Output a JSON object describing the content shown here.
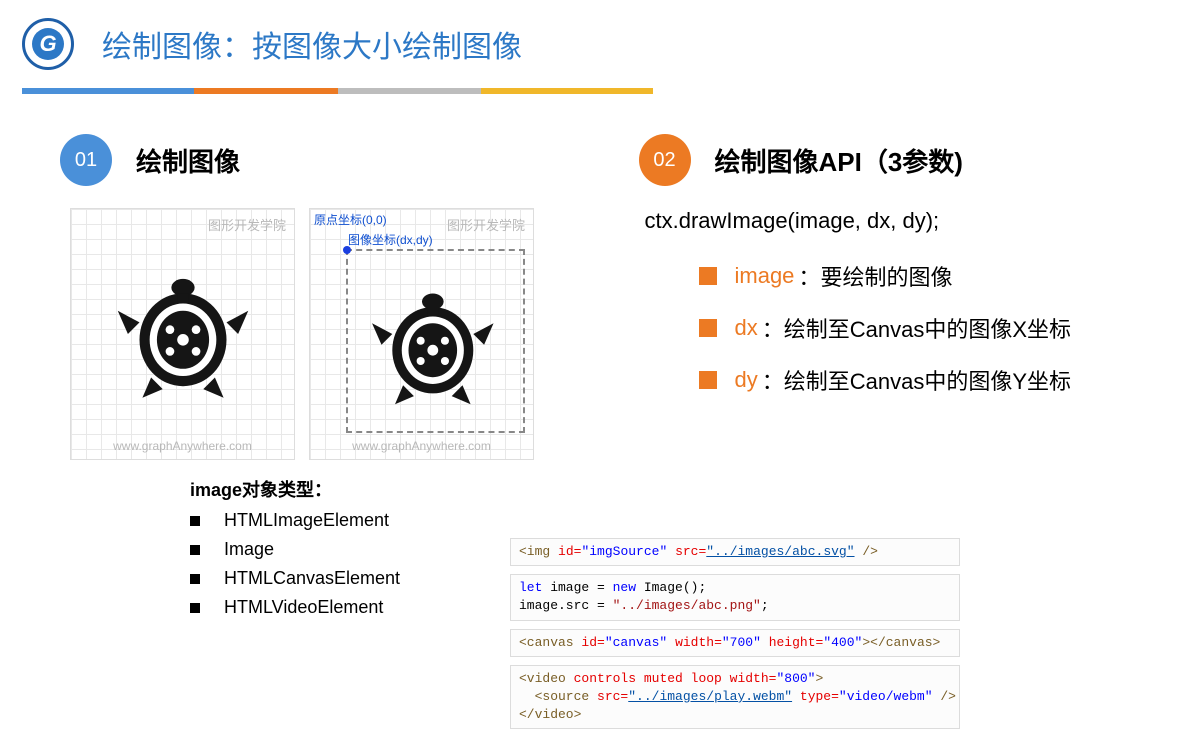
{
  "header": {
    "logo_letter": "G",
    "title": "绘制图像：按图像大小绘制图像"
  },
  "section1": {
    "num": "01",
    "title": "绘制图像",
    "watermark_top": "图形开发学院",
    "watermark_bottom": "www.graphAnywhere.com",
    "coord_origin": "原点坐标(0,0)",
    "coord_image": "图像坐标(dx,dy)",
    "types_title": "image对象类型：",
    "types": [
      "HTMLImageElement",
      "Image",
      "HTMLCanvasElement",
      "HTMLVideoElement"
    ]
  },
  "section2": {
    "num": "02",
    "title": "绘制图像API（3参数)",
    "api": "ctx.drawImage(image, dx, dy);",
    "params": [
      {
        "name": "image",
        "sep": "：",
        "desc": "要绘制的图像"
      },
      {
        "name": "dx",
        "sep": "：",
        "desc": "绘制至Canvas中的图像X坐标"
      },
      {
        "name": "dy",
        "sep": "：",
        "desc": "绘制至Canvas中的图像Y坐标"
      }
    ]
  },
  "code": {
    "img": {
      "tag_open": "<img",
      "attr_id": "id=",
      "val_id": "\"imgSource\"",
      "attr_src": "src=",
      "val_src": "\"../images/abc.svg\"",
      "close": " />"
    },
    "js": {
      "line1_a": "let",
      "line1_b": " image = ",
      "line1_c": "new",
      "line1_d": " Image();",
      "line2_a": "image.src = ",
      "line2_b": "\"../images/abc.png\"",
      "line2_c": ";"
    },
    "canvas": {
      "tag_open": "<canvas",
      "attr_id": "id=",
      "val_id": "\"canvas\"",
      "attr_w": "width=",
      "val_w": "\"700\"",
      "attr_h": "height=",
      "val_h": "\"400\"",
      "mid": ">",
      "tag_close": "</canvas>"
    },
    "video": {
      "tag_open": "<video",
      "attrs": "controls muted loop width=",
      "val_w": "\"800\"",
      "open_end": ">",
      "src_open": "  <source",
      "attr_src": "src=",
      "val_src": "\"../images/play.webm\"",
      "attr_type": "type=",
      "val_type": "\"video/webm\"",
      "src_close": " />",
      "tag_close": "</video>"
    }
  }
}
